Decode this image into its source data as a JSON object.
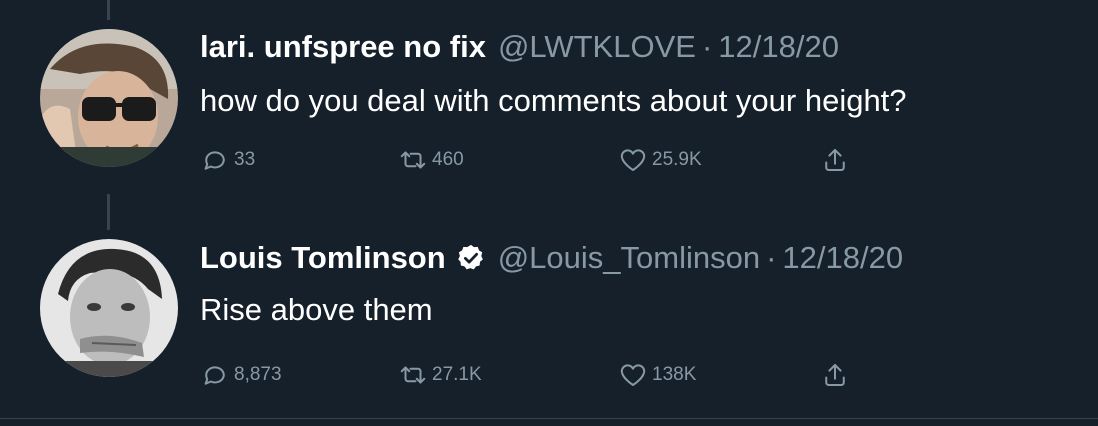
{
  "tweets": [
    {
      "display_name": "lari. unfspree no fix",
      "handle": "@LWTKLOVE",
      "separator": "·",
      "date": "12/18/20",
      "verified": false,
      "text": "how do you deal with comments about your height?",
      "replies": "33",
      "retweets": "460",
      "likes": "25.9K"
    },
    {
      "display_name": "Louis Tomlinson",
      "handle": "@Louis_Tomlinson",
      "separator": "·",
      "date": "12/18/20",
      "verified": true,
      "text": "Rise above them",
      "replies": "8,873",
      "retweets": "27.1K",
      "likes": "138K"
    }
  ],
  "icons": {
    "reply": "speech-bubble-icon",
    "retweet": "retweet-icon",
    "like": "heart-icon",
    "share": "share-icon",
    "verified": "verified-badge-icon"
  },
  "colors": {
    "background": "#15202b",
    "secondary_text": "#8899a6",
    "primary_text": "#ffffff",
    "divider": "#38444d"
  }
}
